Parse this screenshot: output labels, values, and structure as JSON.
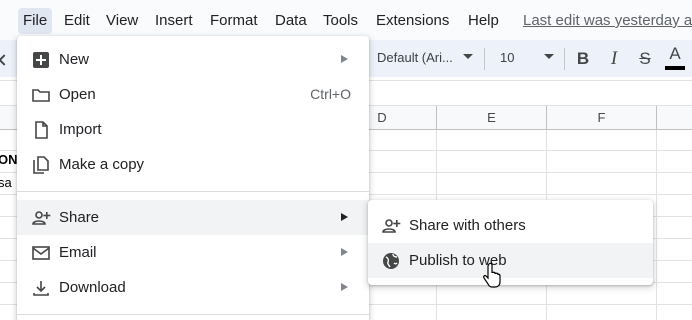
{
  "menubar": {
    "items": [
      "File",
      "Edit",
      "View",
      "Insert",
      "Format",
      "Data",
      "Tools",
      "Extensions",
      "Help"
    ],
    "last_edit": "Last edit was yesterday a"
  },
  "toolbar": {
    "font_name": "Default (Ari...",
    "font_size": "10",
    "bold_label": "B",
    "italic_label": "I",
    "strike_label": "S",
    "text_color_label": "A",
    "text_color": "#000000"
  },
  "grid": {
    "columns": [
      "D",
      "E",
      "F"
    ],
    "cells": [
      "ON",
      "sa"
    ]
  },
  "file_menu": {
    "new_label": "New",
    "open_label": "Open",
    "open_shortcut": "Ctrl+O",
    "import_label": "Import",
    "make_copy_label": "Make a copy",
    "share_label": "Share",
    "email_label": "Email",
    "download_label": "Download"
  },
  "share_submenu": {
    "share_with_others_label": "Share with others",
    "publish_to_web_label": "Publish to web"
  },
  "colors": {
    "menubar_bg": "#f9fbfd",
    "toolbar_bg": "#edf2fa",
    "active_menu_bg": "#e1e7f1",
    "hover_bg": "#f1f3f4"
  }
}
